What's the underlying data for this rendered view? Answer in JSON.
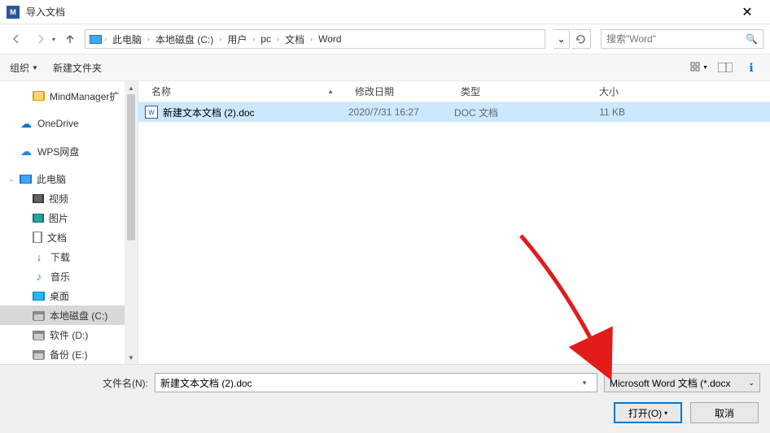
{
  "title": "导入文档",
  "nav": {
    "back": "←",
    "forward": "→",
    "up": "↑"
  },
  "breadcrumb": [
    "此电脑",
    "本地磁盘 (C:)",
    "用户",
    "pc",
    "文档",
    "Word"
  ],
  "search": {
    "placeholder": "搜索\"Word\""
  },
  "toolbar": {
    "organize": "组织",
    "newfolder": "新建文件夹"
  },
  "columns": {
    "name": "名称",
    "date": "修改日期",
    "type": "类型",
    "size": "大小"
  },
  "tree": [
    {
      "label": "MindManager扩",
      "icon": "folder",
      "indent": true
    },
    {
      "label": "OneDrive",
      "icon": "onedrive"
    },
    {
      "label": "WPS网盘",
      "icon": "wps"
    },
    {
      "label": "此电脑",
      "icon": "pc",
      "expandable": true
    },
    {
      "label": "视频",
      "icon": "video",
      "indent": true
    },
    {
      "label": "图片",
      "icon": "pic",
      "indent": true
    },
    {
      "label": "文档",
      "icon": "doc",
      "indent": true
    },
    {
      "label": "下载",
      "icon": "dl",
      "indent": true
    },
    {
      "label": "音乐",
      "icon": "music",
      "indent": true
    },
    {
      "label": "桌面",
      "icon": "desk",
      "indent": true
    },
    {
      "label": "本地磁盘 (C:)",
      "icon": "drive",
      "indent": true,
      "selected": true
    },
    {
      "label": "软件 (D:)",
      "icon": "drive",
      "indent": true
    },
    {
      "label": "备份 (E:)",
      "icon": "drive",
      "indent": true
    }
  ],
  "files": [
    {
      "name": "新建文本文档 (2).doc",
      "date": "2020/7/31 16:27",
      "type": "DOC 文档",
      "size": "11 KB",
      "selected": true
    }
  ],
  "footer": {
    "filename_label": "文件名(N):",
    "filename_value": "新建文本文档 (2).doc",
    "filter": "Microsoft Word 文档 (*.docx",
    "open": "打开(O)",
    "cancel": "取消"
  }
}
